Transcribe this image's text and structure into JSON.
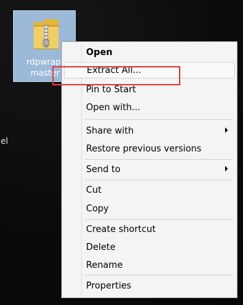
{
  "desktop": {
    "icon": {
      "name_line1": "rdpwrap-",
      "name_line2": "master",
      "icon_name": "zip-folder-icon"
    },
    "side_label": "el"
  },
  "context_menu": {
    "items": [
      {
        "label": "Open"
      },
      {
        "label": "Extract All..."
      },
      {
        "label": "Pin to Start"
      },
      {
        "label": "Open with..."
      },
      {
        "label": "Share with"
      },
      {
        "label": "Restore previous versions"
      },
      {
        "label": "Send to"
      },
      {
        "label": "Cut"
      },
      {
        "label": "Copy"
      },
      {
        "label": "Create shortcut"
      },
      {
        "label": "Delete"
      },
      {
        "label": "Rename"
      },
      {
        "label": "Properties"
      }
    ]
  },
  "colors": {
    "highlight_border": "#e0403f",
    "selection_background": "#a8c8e9",
    "menu_background": "#f4f4f4"
  }
}
